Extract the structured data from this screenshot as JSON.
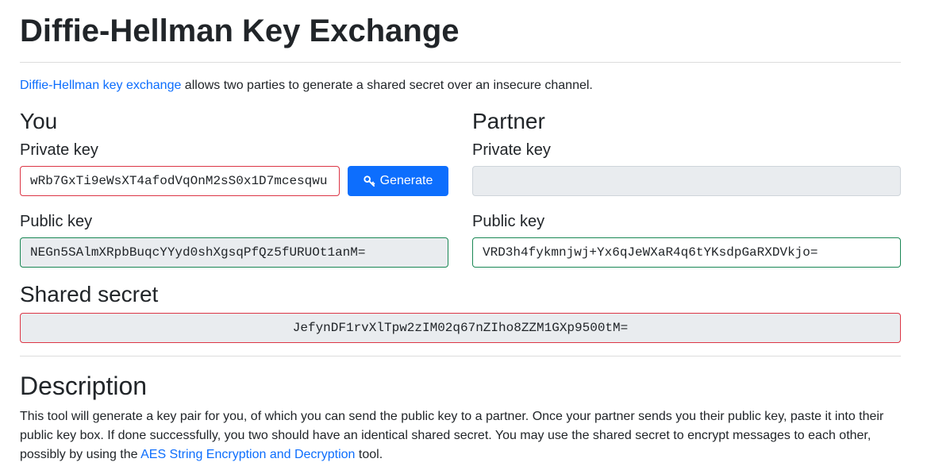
{
  "page": {
    "title": "Diffie-Hellman Key Exchange",
    "intro_link": "Diffie-Hellman key exchange",
    "intro_text": " allows two parties to generate a shared secret over an insecure channel."
  },
  "you": {
    "heading": "You",
    "private_key_label": "Private key",
    "private_key_value": "wRb7GxTi9eWsXT4afodVqOnM2sS0x1D7mcesqwu",
    "generate_label": "Generate",
    "generate_icon": "key-icon",
    "public_key_label": "Public key",
    "public_key_value": "NEGn5SAlmXRpbBuqcYYyd0shXgsqPfQz5fURUOt1anM="
  },
  "partner": {
    "heading": "Partner",
    "private_key_label": "Private key",
    "private_key_value": "",
    "public_key_label": "Public key",
    "public_key_value": "VRD3h4fykmnjwj+Yx6qJeWXaR4q6tYKsdpGaRXDVkjo="
  },
  "shared": {
    "heading": "Shared secret",
    "value": "JefynDF1rvXlTpw2zIM02q67nZIho8ZZM1GXp9500tM="
  },
  "description": {
    "heading": "Description",
    "text_1": "This tool will generate a key pair for you, of which you can send the public key to a partner. Once your partner sends you their public key, paste it into their public key box. If done successfully, you two should have an identical shared secret. You may use the shared secret to encrypt messages to each other, possibly by using the ",
    "link": "AES String Encryption and Decryption",
    "text_2": " tool."
  },
  "colors": {
    "accent": "#0d6efd",
    "invalid": "#dc3545",
    "valid": "#198754",
    "readonly_bg": "#e9ecef"
  }
}
